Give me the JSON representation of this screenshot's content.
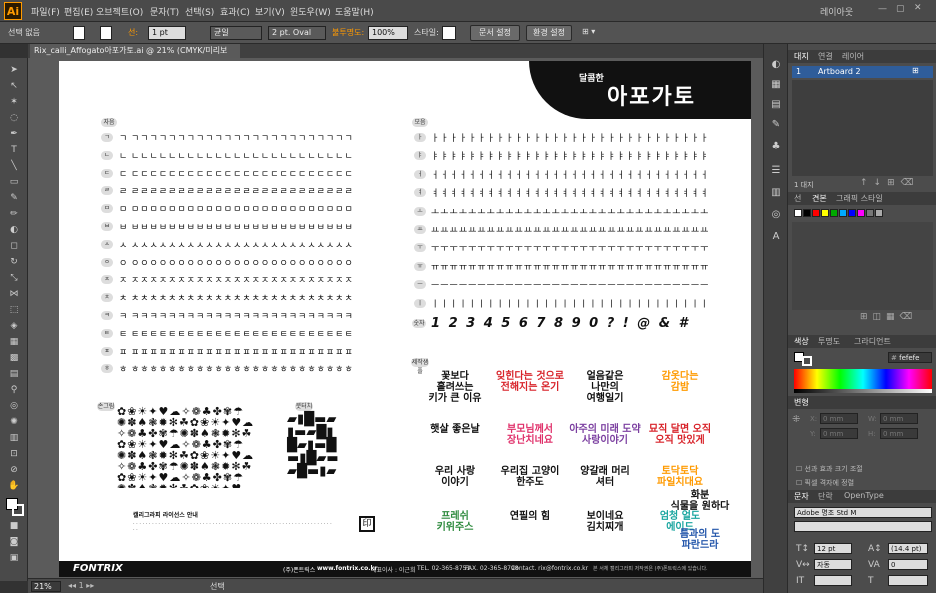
{
  "app": {
    "logo": "Ai",
    "menus": [
      "파일(F)",
      "편집(E)",
      "오브젝트(O)",
      "문자(T)",
      "선택(S)",
      "효과(C)",
      "보기(V)",
      "윈도우(W)",
      "도움말(H)"
    ],
    "workspace": "레이아웃"
  },
  "control": {
    "select_none": "선택 없음",
    "stroke_label": "선:",
    "stroke_weight": "1 pt",
    "stroke_profile": "균일",
    "brush": "2 pt. Oval",
    "opacity_label": "불투명도:",
    "opacity": "100%",
    "style_label": "스타일:",
    "doc_setup": "문서 설정",
    "prefs": "환경 설정"
  },
  "document": {
    "tab": "Rix_calli_Affogato아포가토.ai @ 21% (CMYK/미리보기)"
  },
  "status": {
    "zoom": "21%",
    "tool": "선택"
  },
  "panels": {
    "artboards": {
      "tabs": [
        "대지",
        "연결",
        "레이어"
      ],
      "item_num": "1",
      "item_name": "Artboard 2",
      "count": "1 대지"
    },
    "swatches": {
      "tabs": [
        "선",
        "견본",
        "그래픽 스타일"
      ]
    },
    "color": {
      "tabs": [
        "색상",
        "투명도",
        "그라디언트"
      ],
      "hex": "fefefe"
    },
    "transform": {
      "tab": "변형",
      "x_label": "X:",
      "y_label": "Y:",
      "w_label": "W:",
      "h_label": "H:",
      "x": "0 mm",
      "y": "0 mm",
      "w": "0 mm",
      "h": "0 mm"
    },
    "options": [
      "선과 효과 크기 조절",
      "픽셀 격자에 정렬"
    ],
    "character": {
      "tabs": [
        "문자",
        "단락",
        "OpenType"
      ],
      "font": "Adobe 명조 Std M",
      "size": "12 pt",
      "leading": "(14.4 pt)",
      "tracking": "0",
      "kerning": "자동"
    }
  },
  "artboard": {
    "calligraphy_tag": "calligraphy",
    "title_small": "달콤한",
    "title_big": "아포가토",
    "left_header": "자음",
    "right_header": "모음",
    "consonants": [
      "ㄱ",
      "ㄴ",
      "ㄷ",
      "ㄹ",
      "ㅁ",
      "ㅂ",
      "ㅅ",
      "ㅇ",
      "ㅈ",
      "ㅊ",
      "ㅋ",
      "ㅌ",
      "ㅍ",
      "ㅎ"
    ],
    "vowels": [
      "ㅏ",
      "ㅑ",
      "ㅓ",
      "ㅕ",
      "ㅗ",
      "ㅛ",
      "ㅜ",
      "ㅠ",
      "ㅡ",
      "ㅣ"
    ],
    "numbers_label": "숫자",
    "numbers_row": "1 2 3 4 5 6 7 8 9 0 ? ! @ & #",
    "ornament_label": "손그림",
    "brush_label": "붓터치",
    "sample_label": "제작샘플",
    "license_title": "캘리그라피 라이선스 안내",
    "samples": [
      "꽃보다\n흘려쓰는\n키가 큰 이유",
      "잊힌다는 것으로\n전해지는 온기",
      "얼음같은\n나만의\n여행일기",
      "감옷다는\n감밤",
      "햇살 좋은날",
      "부모님께서\n장난치네요",
      "아주의 미래 도약\n사랑이야기",
      "묘직 달면 오직\n오직 맛있게",
      "우리 사랑\n이야기",
      "우리집 고양이\n한주도",
      "양갈래 머리\n셔터",
      "토닥토닥\n파일치대요",
      "화분\n식물을 원하다",
      "프레쉬\n키위주스",
      "연필의 힘",
      "보이네요\n김치찌개",
      "엄청 얼도\n에이드",
      "틈과의 도\n파란드라"
    ],
    "footer": {
      "brand": "FONTRIX",
      "company": "(주)폰트릭스",
      "url": "www.fontrix.co.kr",
      "ceo": "대표이사 : 이근희",
      "tel": "TEL. 02-365-8751",
      "fax": "FAX. 02-365-8798",
      "contact": "Contact. rix@fontrix.co.kr",
      "notice": "본 서체 캘리그라피 저작권은 (주)폰트릭스에 있습니다."
    }
  },
  "colors": {
    "accent": "#ff9a00",
    "pink": "#e0306a",
    "teal": "#1aa6a0",
    "red": "#d8232a",
    "green": "#2e8a3e",
    "blue": "#2255aa",
    "purple": "#7b3fa0"
  }
}
